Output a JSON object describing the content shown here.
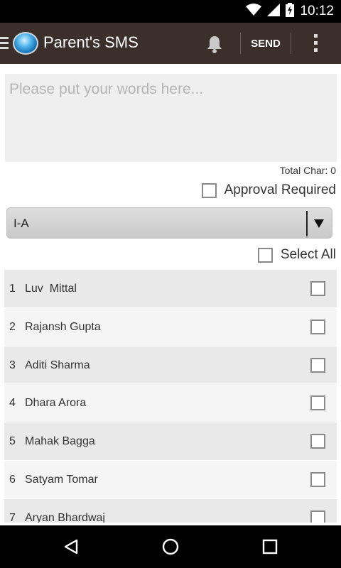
{
  "status_bar": {
    "time": "10:12",
    "icons": [
      "wifi-icon",
      "signal-icon",
      "battery-charging-icon"
    ]
  },
  "action_bar": {
    "title": "Parent's SMS",
    "send_label": "SEND",
    "icons": [
      "menu-icon",
      "app-logo",
      "bell-icon",
      "overflow-menu-icon"
    ]
  },
  "composer": {
    "placeholder": "Please put your words here...",
    "value": "",
    "total_char_label": "Total Char: 0"
  },
  "approval": {
    "label": "Approval Required",
    "checked": false
  },
  "class_selector": {
    "selected": "I-A"
  },
  "select_all": {
    "label": "Select All",
    "checked": false
  },
  "students": [
    {
      "num": "1",
      "name": "Luv  Mittal",
      "checked": false
    },
    {
      "num": "2",
      "name": "Rajansh Gupta",
      "checked": false
    },
    {
      "num": "3",
      "name": "Aditi Sharma",
      "checked": false
    },
    {
      "num": "4",
      "name": "Dhara Arora",
      "checked": false
    },
    {
      "num": "5",
      "name": "Mahak Bagga",
      "checked": false
    },
    {
      "num": "6",
      "name": "Satyam Tomar",
      "checked": false
    },
    {
      "num": "7",
      "name": "Aryan Bhardwaj",
      "checked": false
    }
  ],
  "nav_bar": {
    "icons": [
      "back-icon",
      "home-icon",
      "recents-icon"
    ]
  }
}
